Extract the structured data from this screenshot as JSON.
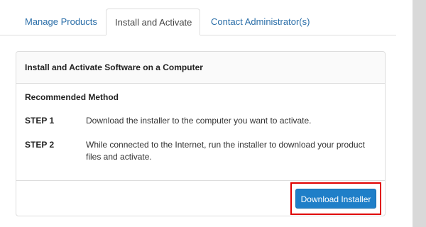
{
  "tabs": [
    {
      "label": "Manage Products",
      "active": false
    },
    {
      "label": "Install and Activate",
      "active": true
    },
    {
      "label": "Contact Administrator(s)",
      "active": false
    }
  ],
  "panel": {
    "title": "Install and Activate Software on a Computer",
    "method_title": "Recommended Method",
    "steps": [
      {
        "label": "STEP 1",
        "text": "Download the installer to the computer you want to activate."
      },
      {
        "label": "STEP 2",
        "text": "While connected to the Internet, run the installer to download your product files and activate."
      }
    ],
    "download_button": "Download Installer"
  },
  "colors": {
    "link": "#2a6ea8",
    "primary_button": "#1f7fc8",
    "highlight": "#e00000"
  }
}
